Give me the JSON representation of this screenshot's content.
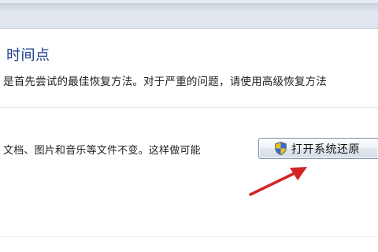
{
  "section": {
    "heading": "时间点",
    "description": "是首先尝试的最佳恢复方法。对于严重的问题，请使用高级恢复方法",
    "info": "文档、图片和音乐等文件不变。这样做可能",
    "button_label": "打开系统还原",
    "button_icon": "uac-shield-icon"
  },
  "annotation": {
    "arrow_icon": "red-arrow-icon",
    "arrow_color": "#d42424"
  },
  "colors": {
    "heading": "#1c3f8e",
    "shield_blue": "#2f6fd0",
    "shield_yellow": "#f2c21c"
  }
}
